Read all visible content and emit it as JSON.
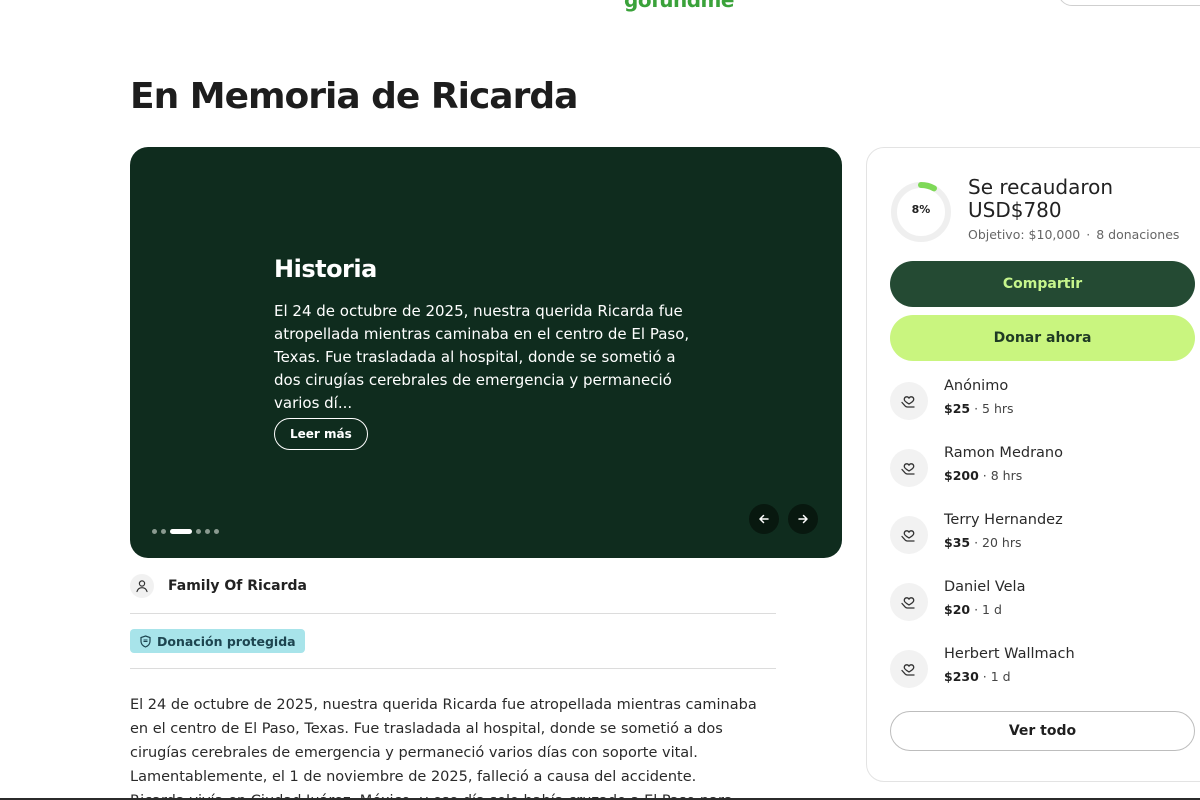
{
  "header": {
    "logo_text": "gofundme"
  },
  "page_title": "En Memoria de Ricarda",
  "story_card": {
    "heading": "Historia",
    "excerpt": "El 24 de octubre de 2025, nuestra querida Ricarda fue atropellada mientras caminaba en el centro de El Paso, Texas. Fue trasladada al hospital, donde se sometió a dos cirugías cerebrales de emergencia y permaneció varios dí...",
    "read_more_label": "Leer más",
    "prev_icon": "arrow-left-icon",
    "next_icon": "arrow-right-icon",
    "slide_count": 6,
    "active_slide": 2,
    "background_color": "#0f2c1e"
  },
  "organizer": {
    "name": "Family Of Ricarda",
    "icon": "user-icon"
  },
  "badge": {
    "label": "Donación protegida",
    "icon": "shield-icon",
    "color": "#a8e4ea"
  },
  "description": "El 24 de octubre de 2025, nuestra querida Ricarda fue atropellada mientras caminaba en el centro de El Paso, Texas. Fue trasladada al hospital, donde se sometió a dos cirugías cerebrales de emergencia y permaneció varios días con soporte vital. Lamentablemente, el 1 de noviembre de 2025, falleció a causa del accidente.",
  "description_cut": "Ricarda vivía en Ciudad Juárez, México, y ese día solo había cruzado a El Paso para hacer",
  "summary": {
    "progress_percent": 8,
    "progress_label": "8%",
    "raised_label": "Se recaudaron",
    "raised_amount": "USD$780",
    "goal": "Objetivo: $10,000",
    "separator": "·",
    "donation_count": "8 donaciones",
    "progress_color": "#7ed957"
  },
  "actions": {
    "share_label": "Compartir",
    "donate_label": "Donar ahora",
    "see_all_label": "Ver todo"
  },
  "donations": [
    {
      "name": "Anónimo",
      "amount": "$25",
      "time": " · 5 hrs",
      "icon": "heart-hand-icon"
    },
    {
      "name": "Ramon Medrano",
      "amount": "$200",
      "time": " · 8 hrs",
      "icon": "heart-hand-icon"
    },
    {
      "name": "Terry Hernandez",
      "amount": "$35",
      "time": " · 20 hrs",
      "icon": "heart-hand-icon"
    },
    {
      "name": "Daniel Vela",
      "amount": "$20",
      "time": " · 1 d",
      "icon": "heart-hand-icon"
    },
    {
      "name": "Herbert Wallmach",
      "amount": "$230",
      "time": " · 1 d",
      "icon": "heart-hand-icon"
    }
  ]
}
